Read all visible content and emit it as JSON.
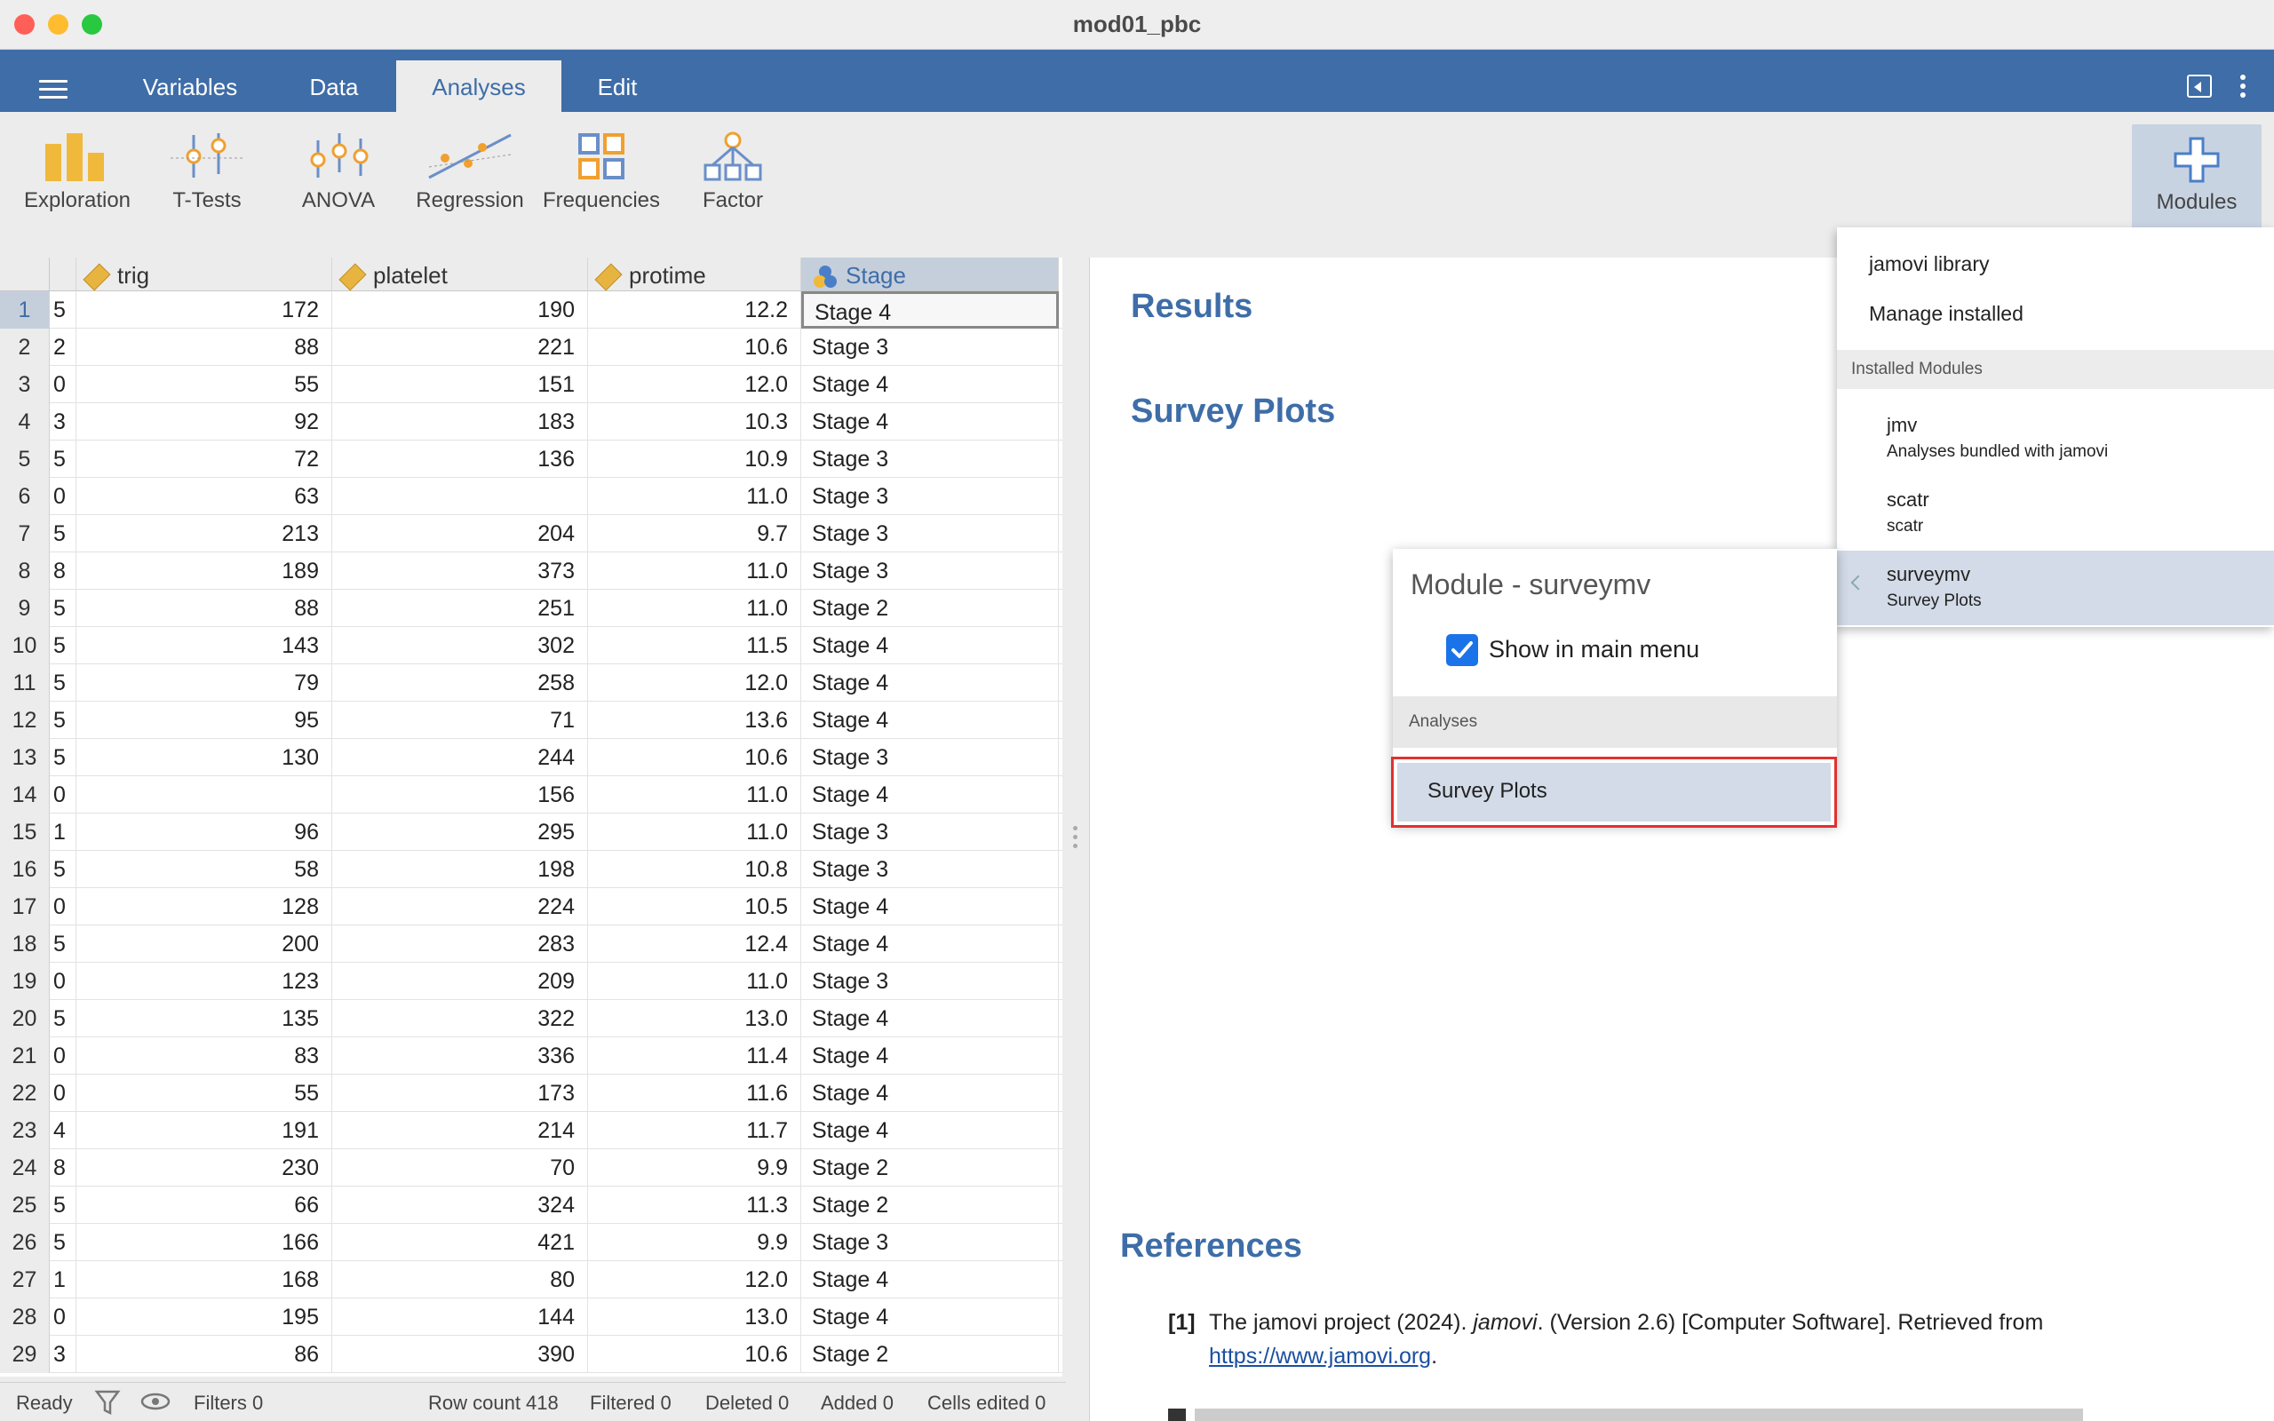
{
  "window": {
    "title": "mod01_pbc"
  },
  "menu": {
    "tabs": [
      "Variables",
      "Data",
      "Analyses",
      "Edit"
    ],
    "active": "Analyses"
  },
  "toolbar": {
    "tools": [
      "Exploration",
      "T-Tests",
      "ANOVA",
      "Regression",
      "Frequencies",
      "Factor"
    ],
    "modules_label": "Modules"
  },
  "grid": {
    "columns": [
      "trig",
      "platelet",
      "protime",
      "Stage"
    ],
    "rows": [
      [
        "1",
        "5",
        "172",
        "190",
        "12.2",
        "Stage 4"
      ],
      [
        "2",
        "2",
        "88",
        "221",
        "10.6",
        "Stage 3"
      ],
      [
        "3",
        "0",
        "55",
        "151",
        "12.0",
        "Stage 4"
      ],
      [
        "4",
        "3",
        "92",
        "183",
        "10.3",
        "Stage 4"
      ],
      [
        "5",
        "5",
        "72",
        "136",
        "10.9",
        "Stage 3"
      ],
      [
        "6",
        "0",
        "63",
        "",
        "11.0",
        "Stage 3"
      ],
      [
        "7",
        "5",
        "213",
        "204",
        "9.7",
        "Stage 3"
      ],
      [
        "8",
        "8",
        "189",
        "373",
        "11.0",
        "Stage 3"
      ],
      [
        "9",
        "5",
        "88",
        "251",
        "11.0",
        "Stage 2"
      ],
      [
        "10",
        "5",
        "143",
        "302",
        "11.5",
        "Stage 4"
      ],
      [
        "11",
        "5",
        "79",
        "258",
        "12.0",
        "Stage 4"
      ],
      [
        "12",
        "5",
        "95",
        "71",
        "13.6",
        "Stage 4"
      ],
      [
        "13",
        "5",
        "130",
        "244",
        "10.6",
        "Stage 3"
      ],
      [
        "14",
        "0",
        "",
        "156",
        "11.0",
        "Stage 4"
      ],
      [
        "15",
        "1",
        "96",
        "295",
        "11.0",
        "Stage 3"
      ],
      [
        "16",
        "5",
        "58",
        "198",
        "10.8",
        "Stage 3"
      ],
      [
        "17",
        "0",
        "128",
        "224",
        "10.5",
        "Stage 4"
      ],
      [
        "18",
        "5",
        "200",
        "283",
        "12.4",
        "Stage 4"
      ],
      [
        "19",
        "0",
        "123",
        "209",
        "11.0",
        "Stage 3"
      ],
      [
        "20",
        "5",
        "135",
        "322",
        "13.0",
        "Stage 4"
      ],
      [
        "21",
        "0",
        "83",
        "336",
        "11.4",
        "Stage 4"
      ],
      [
        "22",
        "0",
        "55",
        "173",
        "11.6",
        "Stage 4"
      ],
      [
        "23",
        "4",
        "191",
        "214",
        "11.7",
        "Stage 4"
      ],
      [
        "24",
        "8",
        "230",
        "70",
        "9.9",
        "Stage 2"
      ],
      [
        "25",
        "5",
        "66",
        "324",
        "11.3",
        "Stage 2"
      ],
      [
        "26",
        "5",
        "166",
        "421",
        "9.9",
        "Stage 3"
      ],
      [
        "27",
        "1",
        "168",
        "80",
        "12.0",
        "Stage 4"
      ],
      [
        "28",
        "0",
        "195",
        "144",
        "13.0",
        "Stage 4"
      ],
      [
        "29",
        "3",
        "86",
        "390",
        "10.6",
        "Stage 2"
      ]
    ]
  },
  "status": {
    "ready": "Ready",
    "filters": "Filters 0",
    "row_count": "Row count 418",
    "filtered": "Filtered 0",
    "deleted": "Deleted 0",
    "added": "Added 0",
    "cells_edited": "Cells edited 0"
  },
  "results": {
    "heading": "Results",
    "survey_heading": "Survey Plots",
    "references_heading": "References",
    "ref1_num": "[1]",
    "ref1_text_a": "The jamovi project (2024).",
    "ref1_italic": "jamovi",
    "ref1_text_b": ". (Version 2.6) [Computer Software]. Retrieved from",
    "ref1_link": "https://www.jamovi.org",
    "ref1_tail": "."
  },
  "modules_menu": {
    "library": "jamovi library",
    "manage": "Manage installed",
    "section": "Installed Modules",
    "modules": [
      {
        "name": "jmv",
        "desc": "Analyses bundled with jamovi"
      },
      {
        "name": "scatr",
        "desc": "scatr"
      },
      {
        "name": "surveymv",
        "desc": "Survey Plots"
      }
    ]
  },
  "module_popup": {
    "title": "Module - surveymv",
    "checkbox_label": "Show in main menu",
    "checked": true,
    "analyses_section": "Analyses",
    "analysis_item": "Survey Plots"
  },
  "colors": {
    "accent": "#3e6da8",
    "highlight_border": "#e03030",
    "checkbox": "#1a73e8"
  }
}
